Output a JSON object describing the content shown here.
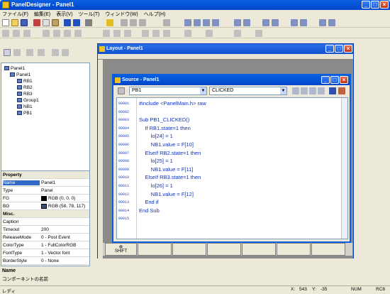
{
  "app": {
    "title": "PanelDesigner - Panel1"
  },
  "menu": [
    "ファイル(F)",
    "編集(E)",
    "表示(V)",
    "ツール(T)",
    "ウィンドウ(W)",
    "ヘルプ(H)"
  ],
  "tree": {
    "nodes": [
      {
        "label": "Panel1",
        "level": 0
      },
      {
        "label": "Panel1",
        "level": 1
      },
      {
        "label": "RB1",
        "level": 2
      },
      {
        "label": "RB2",
        "level": 2
      },
      {
        "label": "RB3",
        "level": 2
      },
      {
        "label": "Group1",
        "level": 2
      },
      {
        "label": "NB1",
        "level": 2
      },
      {
        "label": "PB1",
        "level": 2
      }
    ]
  },
  "props": {
    "section1": "Property",
    "rows1": [
      {
        "k": "Name",
        "v": "Panel1"
      },
      {
        "k": "Type",
        "v": "Panel"
      },
      {
        "k": "FG",
        "v": "RGB (0, 0, 0)",
        "swatch": "#000000"
      },
      {
        "k": "BG",
        "v": "RGB (58, 78, 117)",
        "swatch": "#3a4e75"
      }
    ],
    "section2": "Misc.",
    "rows2": [
      {
        "k": "Caption",
        "v": ""
      },
      {
        "k": "Timeout",
        "v": "200"
      },
      {
        "k": "ReleaseMode",
        "v": "0 - Post Event"
      },
      {
        "k": "ColorType",
        "v": "1 - FullColorRGB"
      },
      {
        "k": "FontType",
        "v": "1 - Vector font"
      },
      {
        "k": "BorderStyle",
        "v": "0 - None"
      }
    ],
    "desc_title": "Name",
    "desc_text": "コンポーネントの名前"
  },
  "layout": {
    "title": "Layout - Panel1"
  },
  "source": {
    "title": "Source - Panel1",
    "object": "PB1",
    "event": "CLICKED",
    "lines": [
      {
        "n": "00001",
        "t": "#include <PanelMain.h> raw"
      },
      {
        "n": "00002",
        "t": ""
      },
      {
        "n": "00003",
        "t": "Sub PB1_CLICKED()"
      },
      {
        "n": "00004",
        "t": "    If RB1.state=1 then"
      },
      {
        "n": "00005",
        "t": "        lo[24] = 1"
      },
      {
        "n": "00006",
        "t": "        NB1.value = F[10]"
      },
      {
        "n": "00007",
        "t": "    ElseIf RB2.state=1 then"
      },
      {
        "n": "00008",
        "t": "        lo[25] = 1"
      },
      {
        "n": "00009",
        "t": "        NB1.value = F[11]"
      },
      {
        "n": "00010",
        "t": "    ElseIf RB3.state=1 then"
      },
      {
        "n": "00011",
        "t": "        lo[26] = 1"
      },
      {
        "n": "00012",
        "t": "        NB1.value = F[12]"
      },
      {
        "n": "00013",
        "t": "    End if"
      },
      {
        "n": "00014",
        "t": "End Sub"
      },
      {
        "n": "00015",
        "t": ""
      }
    ]
  },
  "buttons": {
    "shift": "SHIFT"
  },
  "status": {
    "ready": "レディ",
    "x_label": "X:",
    "x_val": "543",
    "y_label": "Y:",
    "y_val": "-35",
    "num": "NUM",
    "rc": "RC8"
  }
}
